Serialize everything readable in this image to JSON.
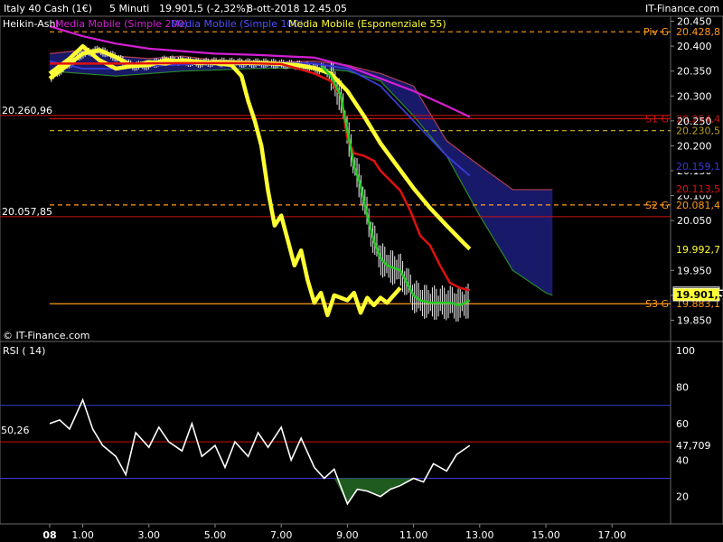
{
  "header": {
    "instrument": "Italy 40 Cash (1€)",
    "interval": "5 Minuti",
    "price": "19.901,5 (-2,32%)",
    "datetime": "8-ott-2018 12.45.05",
    "brand": "IT-Finance.com"
  },
  "legend": {
    "ha": "Heikin-Ashi",
    "ma200": "Media Mobile (Simple 200)",
    "ma100": "Media Mobile (Simple 100)",
    "ema55": "Media Mobile (Esponenziale 55)"
  },
  "watermark": "© IT-Finance.com",
  "colors": {
    "ma200": "#d41fd4",
    "ma100": "#3a3ad8",
    "ema55": "#ffff33",
    "red": "#e01010",
    "green": "#22cc22",
    "orange": "#ff9a1a",
    "cloud": "#1a1a70"
  },
  "chart_data": [
    {
      "type": "line",
      "x_ticks": [
        "08",
        "1.00",
        "3.00",
        "5.00",
        "7.00",
        "9.00",
        "11.00",
        "13.00",
        "15.00",
        "17.00"
      ],
      "ylim": [
        19840,
        20460
      ],
      "y_ticks": [
        19850,
        19900,
        19950,
        20050,
        20100,
        20150,
        20200,
        20250,
        20300,
        20350,
        20400,
        20450
      ],
      "y_tick_labels": [
        "19.850",
        "19.900",
        "19.950",
        "20.050",
        "20.100",
        "20.150",
        "20.200",
        "20.250",
        "20.300",
        "20.350",
        "20.400",
        "20.450"
      ],
      "levels": [
        {
          "name": "Piv G",
          "value": 20428.8,
          "value_label": "20.428,8",
          "style": "dashed",
          "color": "#ff9a1a"
        },
        {
          "name": "S1 G",
          "value": 20254.4,
          "value_label": "20.254,4",
          "style": "solid",
          "color": "#cc1111"
        },
        {
          "name": "",
          "value": 20230.5,
          "value_label": "20.230,5",
          "style": "dashed",
          "color": "#b8a020"
        },
        {
          "name": "S2 G",
          "value": 20081.4,
          "value_label": "20.081,4",
          "style": "dashed",
          "color": "#ff9a1a"
        },
        {
          "name": "S3 G",
          "value": 19883.1,
          "value_label": "19.883,1",
          "style": "solid",
          "color": "#ff9a1a"
        }
      ],
      "left_labels": [
        {
          "text": "20.260,96",
          "value": 20260.96
        },
        {
          "text": "20.057,85",
          "value": 20057.85
        }
      ],
      "right_labels": [
        {
          "text": "20.159,1",
          "value": 20159.1,
          "color": "#3a3ad8"
        },
        {
          "text": "20.113,5",
          "value": 20113.5,
          "color": "#e01010"
        },
        {
          "text": "19.992,7",
          "value": 19992.7,
          "color": "#ffff33"
        },
        {
          "text": "19.904,0",
          "value": 19904.0,
          "color": "#ffffff"
        },
        {
          "text": "19.901,5",
          "value": 19901.5,
          "color": "#ffff33"
        }
      ],
      "series": [
        {
          "name": "Media Mobile (Simple 200)",
          "color": "#d41fd4",
          "x": [
            0,
            1,
            2,
            3,
            4,
            5,
            6,
            6.4,
            7,
            8,
            9,
            10,
            11,
            12,
            12.7
          ],
          "y": [
            20440,
            20420,
            20405,
            20395,
            20390,
            20385,
            20383,
            20382,
            20380,
            20377,
            20360,
            20335,
            20310,
            20280,
            20258
          ]
        },
        {
          "name": "Media Mobile (Simple 100)",
          "color": "#3a3ad8",
          "x": [
            0,
            1,
            2,
            3,
            4,
            5,
            6,
            7,
            8,
            9,
            10,
            11,
            12,
            12.7
          ],
          "y": [
            20370,
            20355,
            20355,
            20360,
            20363,
            20365,
            20366,
            20367,
            20365,
            20355,
            20320,
            20250,
            20180,
            20140
          ]
        },
        {
          "name": "Media Mobile (Esponenziale 55)",
          "color": "#ffff33",
          "x": [
            0,
            0.5,
            1,
            1.5,
            2,
            2.5,
            3,
            3.5,
            4,
            4.5,
            5,
            5.5,
            6,
            6.5,
            7,
            7.5,
            8,
            8.5,
            9,
            9.5,
            10,
            10.5,
            11,
            11.5,
            12,
            12.5,
            12.7
          ],
          "y": [
            20335,
            20360,
            20385,
            20392,
            20378,
            20360,
            20362,
            20372,
            20370,
            20366,
            20368,
            20367,
            20366,
            20366,
            20364,
            20362,
            20356,
            20345,
            20310,
            20260,
            20205,
            20160,
            20115,
            20075,
            20040,
            20006,
            19993
          ]
        },
        {
          "name": "Media Mobile (Esponenziale 55) fast",
          "color": "#ffff33",
          "x": [
            0,
            0.3,
            0.6,
            1,
            1.5,
            2,
            2.5,
            3,
            3.5,
            4,
            4.5,
            5,
            5.5,
            5.8,
            6.0,
            6.2,
            6.4,
            6.6,
            6.8,
            7,
            7.2,
            7.4,
            7.6,
            7.8,
            8,
            8.2,
            8.4,
            8.6,
            8.8,
            9,
            9.2,
            9.4,
            9.6,
            9.8,
            10,
            10.2,
            10.4,
            10.6
          ],
          "y": [
            20345,
            20360,
            20375,
            20400,
            20372,
            20355,
            20360,
            20368,
            20365,
            20372,
            20369,
            20366,
            20362,
            20340,
            20290,
            20250,
            20200,
            20110,
            20040,
            20060,
            20010,
            19960,
            19990,
            19930,
            19885,
            19905,
            19860,
            19900,
            19895,
            19890,
            19905,
            19865,
            19895,
            19880,
            19895,
            19885,
            19900,
            19915
          ]
        },
        {
          "name": "Red MA",
          "color": "#e01010",
          "x": [
            0,
            2,
            4,
            6,
            7,
            7.5,
            8,
            8.5,
            8.8,
            9,
            9.2,
            9.5,
            9.8,
            10,
            10.3,
            10.6,
            10.9,
            11.2,
            11.5,
            11.8,
            12.1,
            12.4,
            12.7
          ],
          "y": [
            20365,
            20365,
            20366,
            20366,
            20364,
            20355,
            20345,
            20330,
            20300,
            20215,
            20185,
            20180,
            20170,
            20150,
            20130,
            20110,
            20070,
            20020,
            20000,
            19960,
            19925,
            19915,
            19910
          ]
        },
        {
          "name": "Green MA",
          "color": "#22cc22",
          "x": [
            8.2,
            8.5,
            8.8,
            9,
            9.2,
            9.4,
            9.6,
            9.8,
            10,
            10.2,
            10.4,
            10.6,
            10.8,
            11,
            11.2,
            11.5,
            11.8,
            12.1,
            12.4,
            12.7
          ],
          "y": [
            20360,
            20340,
            20300,
            20230,
            20160,
            20120,
            20060,
            20010,
            19975,
            19960,
            19955,
            19950,
            19925,
            19900,
            19890,
            19885,
            19885,
            19885,
            19880,
            19890
          ]
        }
      ],
      "cloud": {
        "x": [
          0,
          1,
          2,
          3,
          4,
          5,
          6,
          7,
          8,
          9,
          10,
          11,
          12,
          13,
          14,
          15,
          15.2
        ],
        "upper": [
          20385,
          20392,
          20380,
          20375,
          20380,
          20372,
          20370,
          20368,
          20370,
          20362,
          20345,
          20320,
          20210,
          20160,
          20112,
          20112,
          20112
        ],
        "lower": [
          20350,
          20345,
          20340,
          20345,
          20350,
          20352,
          20355,
          20356,
          20356,
          20350,
          20330,
          20260,
          20180,
          20060,
          19950,
          19905,
          19900
        ]
      }
    },
    {
      "type": "line",
      "title": "RSI ( 14)",
      "ylim": [
        5,
        105
      ],
      "y_ticks": [
        20,
        40,
        60,
        80,
        100
      ],
      "levels": [
        {
          "value": 70,
          "color": "#3a3ad8"
        },
        {
          "value": 50,
          "color": "#cc1111"
        },
        {
          "value": 30,
          "color": "#3a3ad8"
        }
      ],
      "left_label": "50,26",
      "current_label": "47,709",
      "x": [
        0,
        0.3,
        0.6,
        1,
        1.3,
        1.6,
        2,
        2.3,
        2.6,
        3,
        3.3,
        3.6,
        4,
        4.3,
        4.6,
        5,
        5.3,
        5.6,
        6,
        6.3,
        6.6,
        7,
        7.3,
        7.6,
        8,
        8.3,
        8.6,
        9,
        9.3,
        9.6,
        10,
        10.3,
        10.6,
        11,
        11.3,
        11.6,
        12,
        12.3,
        12.7
      ],
      "values": [
        60,
        62,
        57,
        73,
        57,
        48,
        42,
        32,
        55,
        47,
        58,
        50,
        45,
        60,
        42,
        48,
        36,
        50,
        42,
        55,
        47,
        58,
        40,
        52,
        36,
        30,
        35,
        16,
        24,
        23,
        20,
        24,
        26,
        30,
        28,
        38,
        34,
        43,
        48
      ]
    }
  ]
}
